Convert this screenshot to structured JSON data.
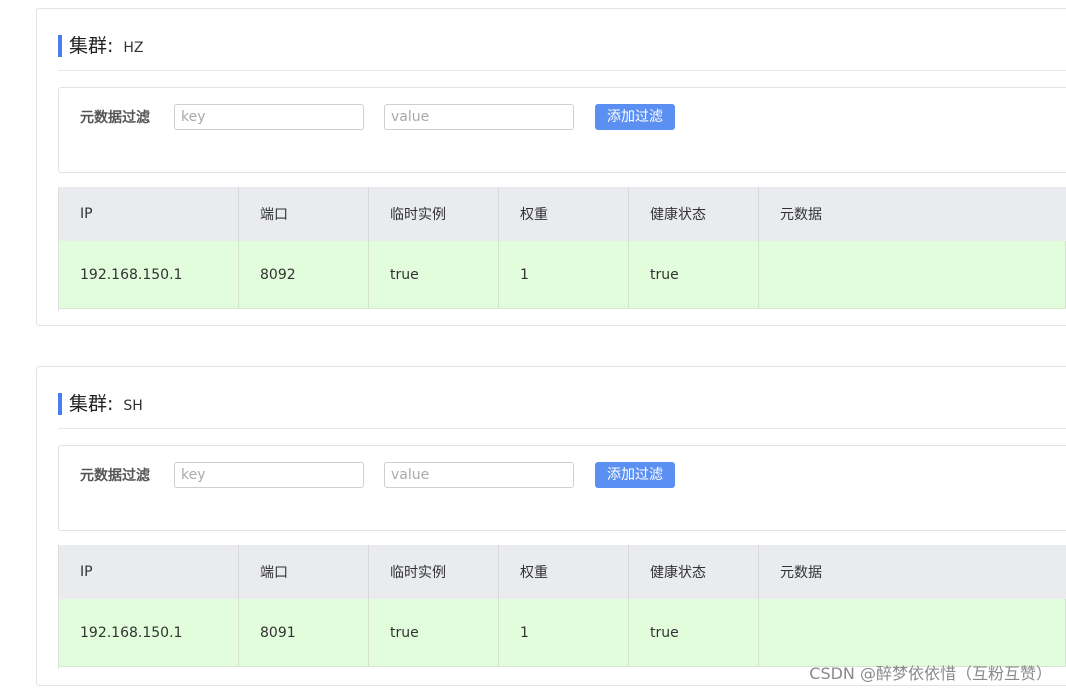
{
  "cluster_label": "集群:",
  "filter": {
    "label": "元数据过滤",
    "key_placeholder": "key",
    "value_placeholder": "value",
    "add_button": "添加过滤"
  },
  "table_headers": [
    "IP",
    "端口",
    "临时实例",
    "权重",
    "健康状态",
    "元数据"
  ],
  "clusters": [
    {
      "name": "HZ",
      "rows": [
        {
          "ip": "192.168.150.1",
          "port": "8092",
          "ephemeral": "true",
          "weight": "1",
          "healthy": "true",
          "metadata": ""
        }
      ]
    },
    {
      "name": "SH",
      "rows": [
        {
          "ip": "192.168.150.1",
          "port": "8091",
          "ephemeral": "true",
          "weight": "1",
          "healthy": "true",
          "metadata": ""
        }
      ]
    }
  ],
  "colors": {
    "accent": "#4a7df0",
    "button": "#5b8ff2",
    "header_bg": "#e9ebee",
    "healthy_row_bg": "#e1fddb"
  },
  "watermark": "CSDN @醉梦依依惜（互粉互赞）"
}
